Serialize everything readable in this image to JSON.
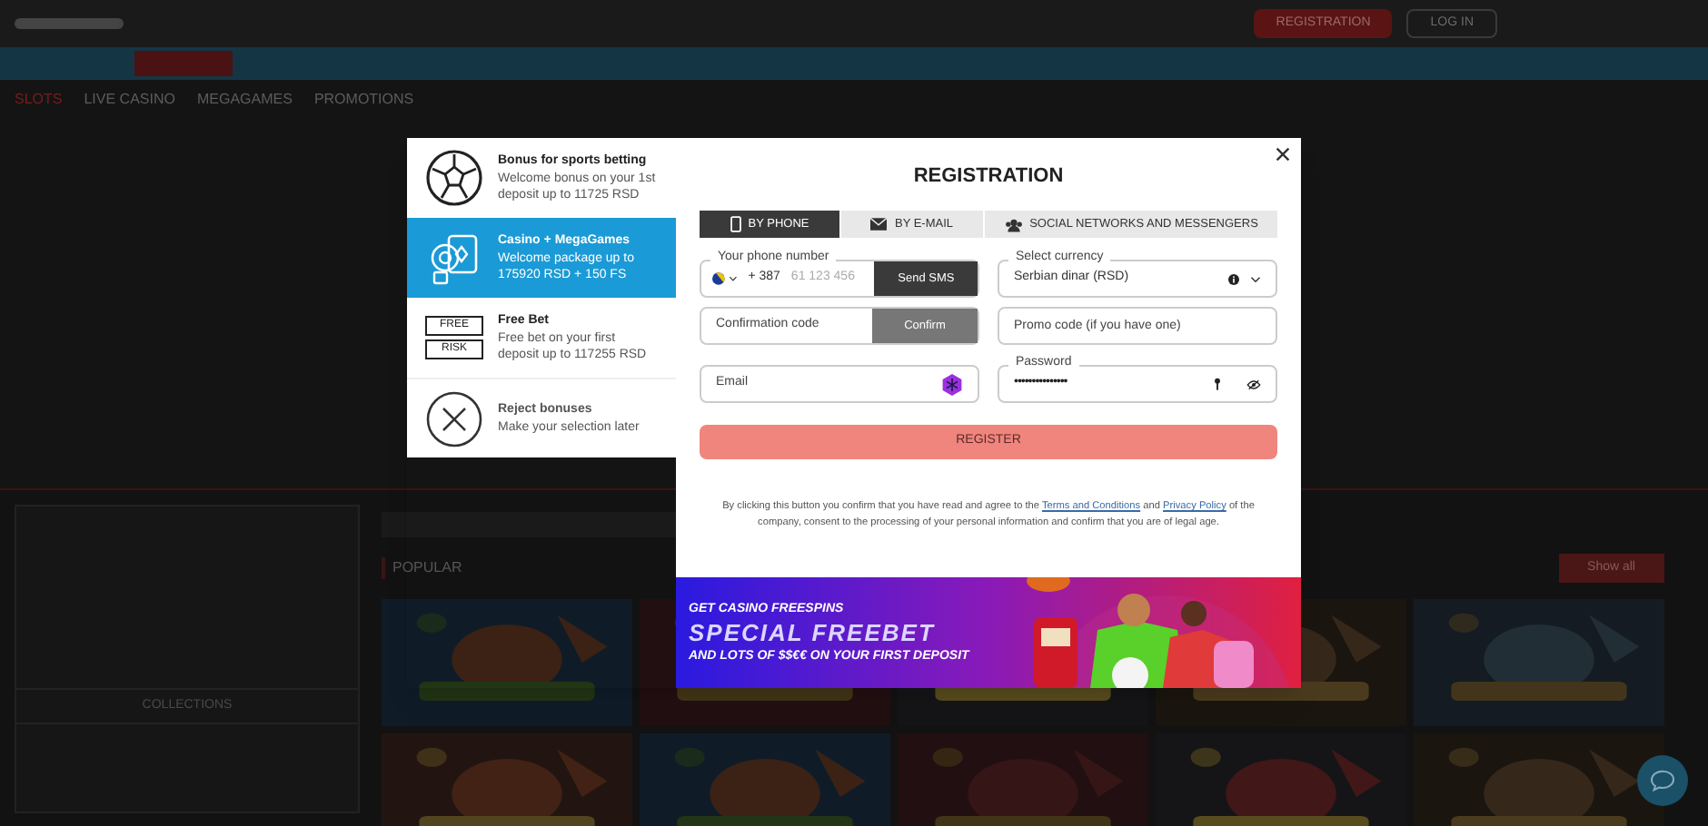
{
  "header": {
    "buttons": [
      {
        "label": "REGISTRATION",
        "kind": "primary"
      },
      {
        "label": "LOG IN",
        "kind": "outline"
      }
    ]
  },
  "subnav": [
    {
      "label": "SLOTS",
      "selected": true
    },
    {
      "label": "LIVE CASINO",
      "selected": false
    },
    {
      "label": "MEGAGAMES",
      "selected": false
    },
    {
      "label": "PROMOTIONS",
      "selected": false
    }
  ],
  "sidebar": {
    "collections_title": "COLLECTIONS"
  },
  "games": {
    "title": "POPULAR",
    "show_all": "Show all"
  },
  "bonuses": [
    {
      "kind": "ball",
      "title": "Bonus for sports betting",
      "description": "Welcome bonus on your 1st deposit up to 11725 RSD",
      "selected": false
    },
    {
      "kind": "casino",
      "title": "Casino + MegaGames",
      "description": "Welcome package up to 175920 RSD + 150 FS",
      "selected": true
    },
    {
      "kind": "freebet",
      "title": "Free Bet",
      "description": "Free bet on your first deposit up to 117255 RSD",
      "selected": false,
      "badges": [
        "FREE",
        "RISK"
      ]
    },
    {
      "kind": "reject",
      "title": "Reject bonuses",
      "description": "Make your selection later",
      "selected": false
    }
  ],
  "registration": {
    "title": "REGISTRATION",
    "tabs": [
      {
        "kind": "phone",
        "label": "BY PHONE",
        "selected": true
      },
      {
        "kind": "email",
        "label": "BY E-MAIL",
        "selected": false
      },
      {
        "kind": "social",
        "label": "SOCIAL NETWORKS AND MESSENGERS",
        "selected": false
      }
    ],
    "phone": {
      "label": "Your phone number",
      "code": "+ 387",
      "placeholder": "61 123 456",
      "button": "Send SMS"
    },
    "currency": {
      "label": "Select currency",
      "value": "Serbian dinar (RSD)"
    },
    "confirmation": {
      "placeholder": "Confirmation code",
      "button": "Confirm"
    },
    "promo": {
      "placeholder": "Promo code (if you have one)"
    },
    "email": {
      "placeholder": "Email"
    },
    "password": {
      "label": "Password",
      "value": "•••••••••••••••"
    },
    "submit": "REGISTER",
    "legal": {
      "before": "By clicking this button you confirm that you have read and agree to the",
      "terms": "Terms and Conditions",
      "middle": "and",
      "privacy": "Privacy Policy",
      "after": "of the company, consent to the processing of your personal information and confirm that you are of legal age."
    }
  },
  "banner": {
    "line1": "GET CASINO FREESPINS",
    "line2": "SPECIAL FREEBET",
    "line3": "AND LOTS OF $$€€ ON YOUR FIRST DEPOSIT"
  }
}
